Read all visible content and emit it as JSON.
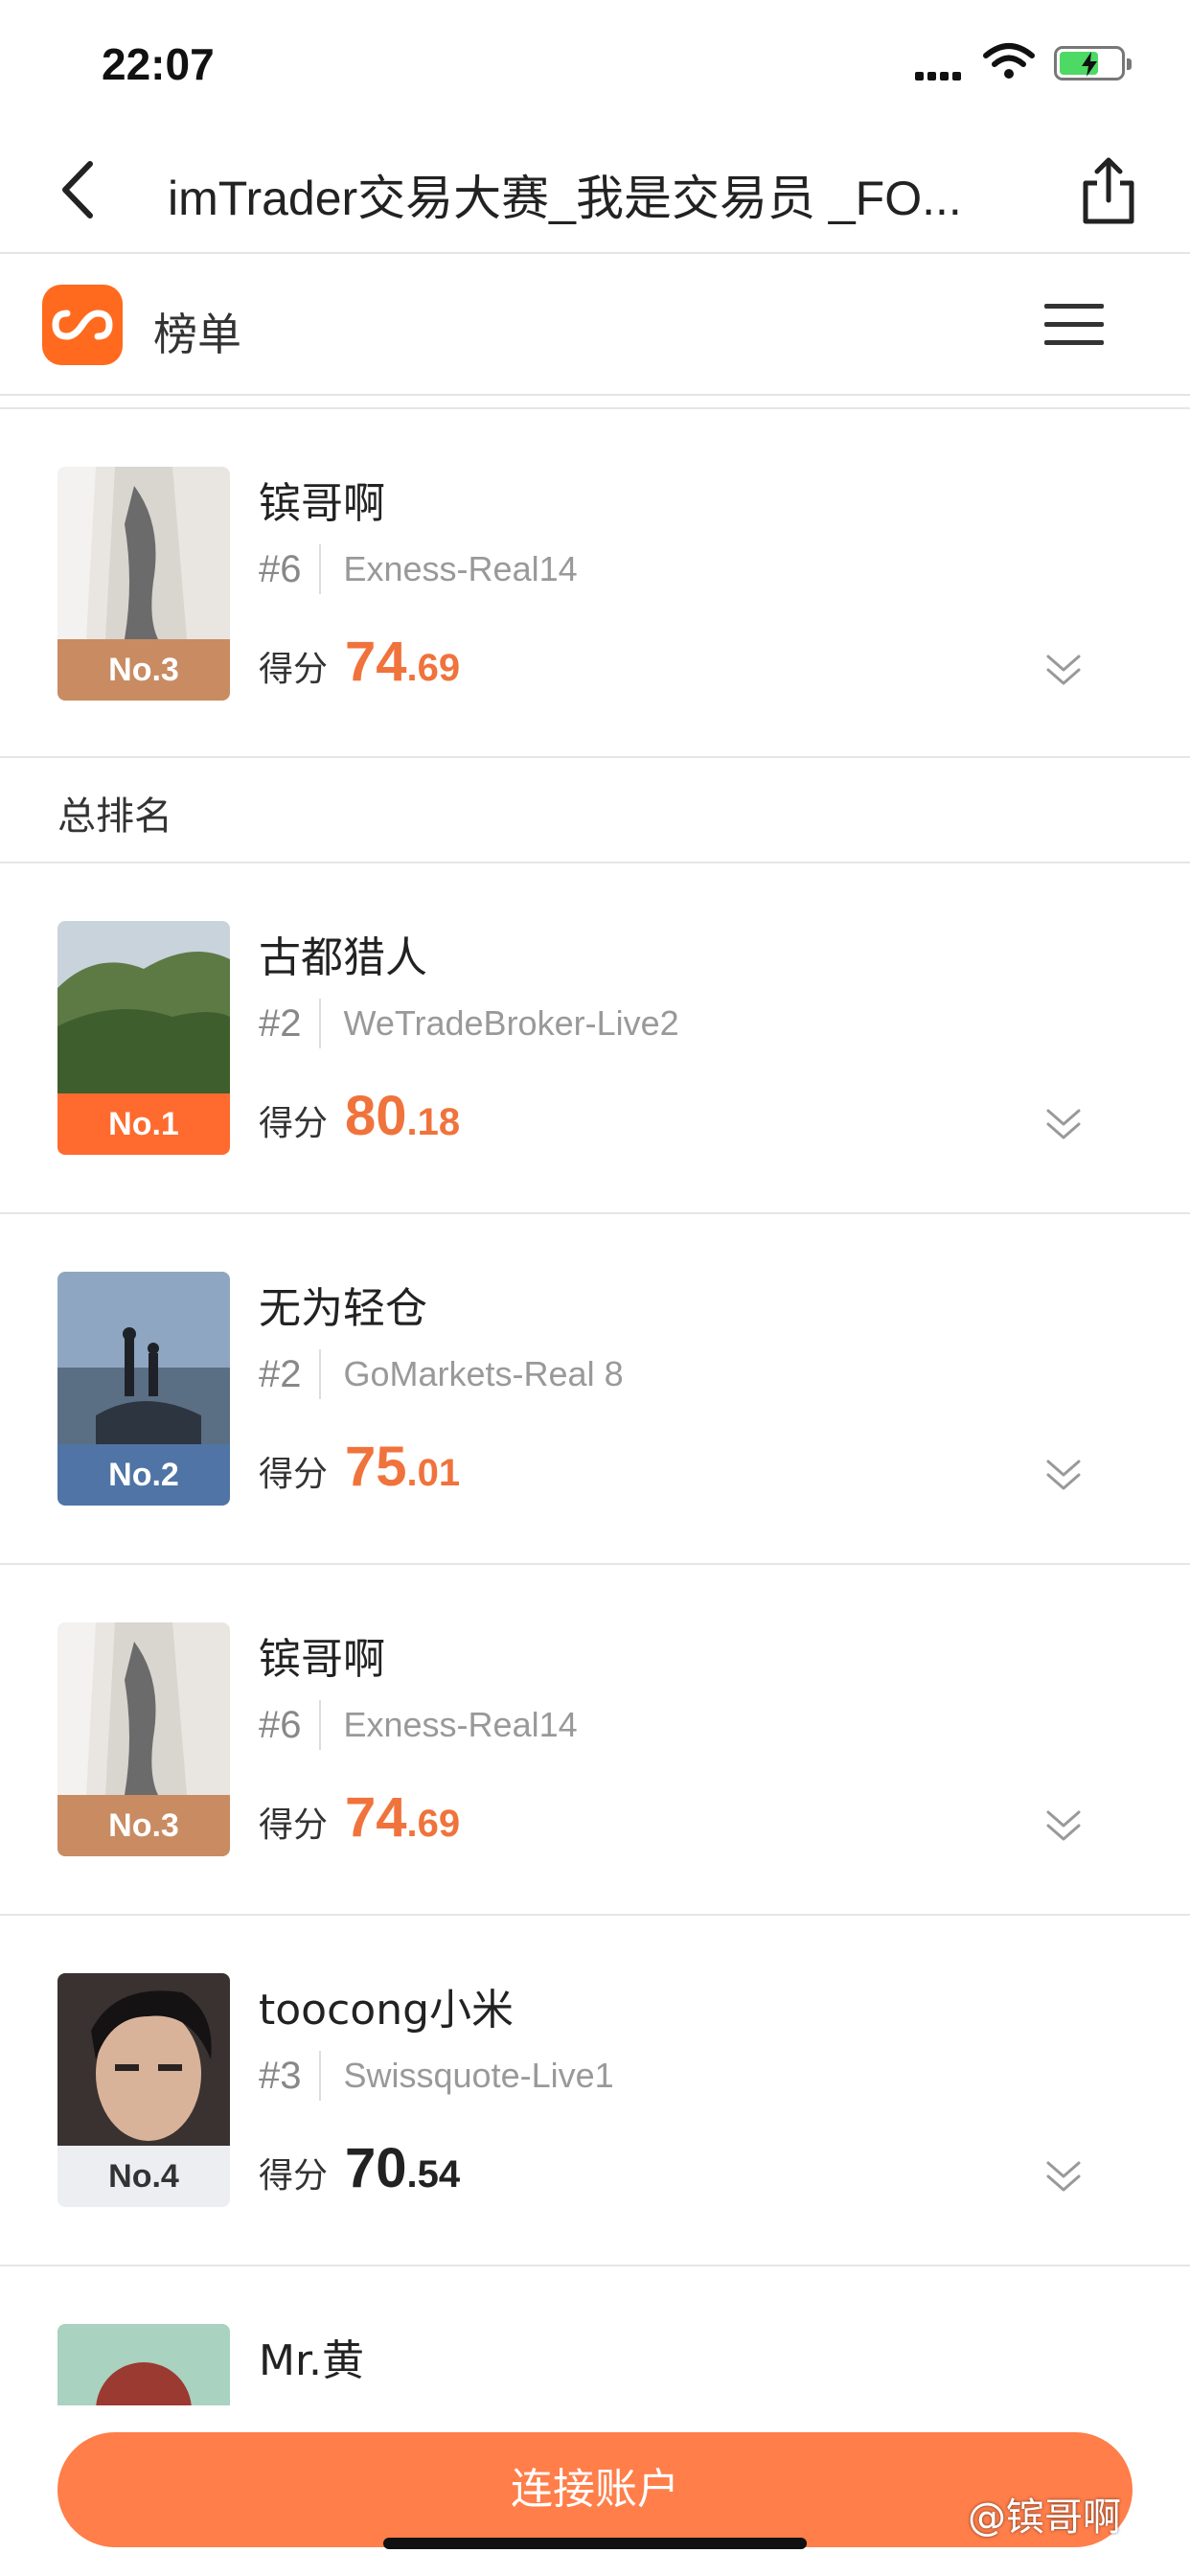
{
  "status_bar": {
    "time": "22:07"
  },
  "nav": {
    "title": "imTrader交易大赛_我是交易员 _FO..."
  },
  "header": {
    "title": "榜单"
  },
  "pinned": {
    "name": "镔哥啊",
    "rank": "#6",
    "broker": "Exness-Real14",
    "badge": "No.3",
    "score_label": "得分",
    "score_int": "74",
    "score_dec": ".69"
  },
  "section": {
    "title": "总排名"
  },
  "traders": [
    {
      "name": "古都猎人",
      "rank": "#2",
      "broker": "WeTradeBroker-Live2",
      "badge": "No.1",
      "score_label": "得分",
      "score_int": "80",
      "score_dec": ".18"
    },
    {
      "name": "无为轻仓",
      "rank": "#2",
      "broker": "GoMarkets-Real 8",
      "badge": "No.2",
      "score_label": "得分",
      "score_int": "75",
      "score_dec": ".01"
    },
    {
      "name": "镔哥啊",
      "rank": "#6",
      "broker": "Exness-Real14",
      "badge": "No.3",
      "score_label": "得分",
      "score_int": "74",
      "score_dec": ".69"
    },
    {
      "name": "toocong小米",
      "rank": "#3",
      "broker": "Swissquote-Live1",
      "badge": "No.4",
      "score_label": "得分",
      "score_int": "70",
      "score_dec": ".54"
    },
    {
      "name": "Mr.黄"
    }
  ],
  "colors": {
    "accent": "#ff6a1e",
    "score_orange": "#f0733c",
    "badge_no1": "#ff6a2e",
    "badge_no2": "#4f74a5",
    "badge_no3": "#c98b62",
    "badge_no4": "#eceef2"
  },
  "footer": {
    "connect_label": "连接账户",
    "watermark": "@镔哥啊"
  }
}
